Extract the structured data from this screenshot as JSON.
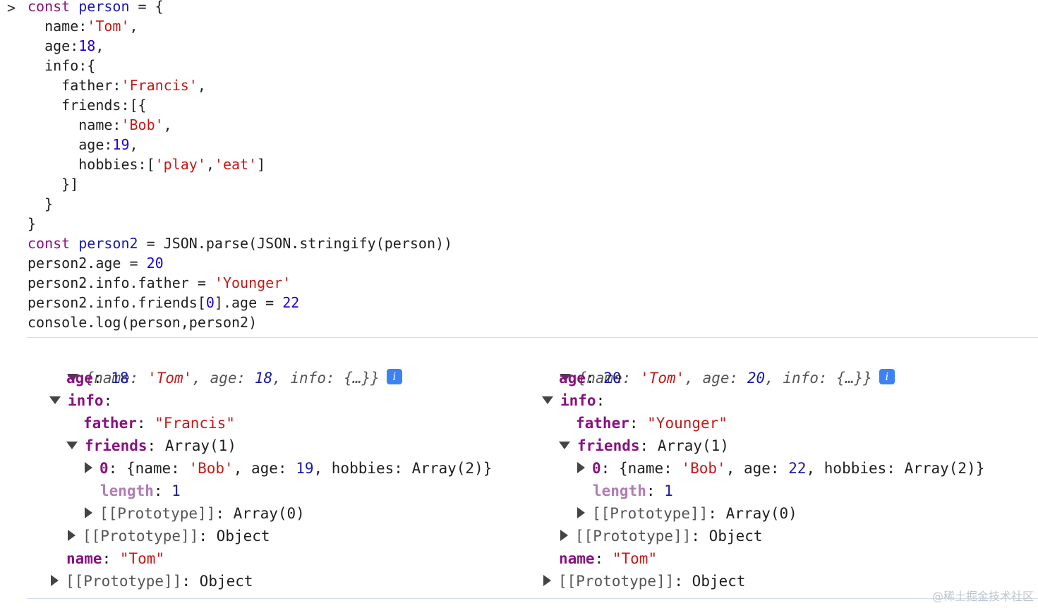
{
  "console": {
    "prompt_symbol": ">",
    "code_lines": [
      [
        [
          "const",
          "kw"
        ],
        [
          " ",
          ""
        ],
        [
          "person",
          "vr"
        ],
        [
          " = {",
          ""
        ]
      ],
      [
        [
          "  name:",
          ""
        ],
        [
          "'Tom'",
          "st"
        ],
        [
          ",",
          ""
        ]
      ],
      [
        [
          "  age:",
          ""
        ],
        [
          "18",
          "nm"
        ],
        [
          ",",
          ""
        ]
      ],
      [
        [
          "  info:{",
          ""
        ]
      ],
      [
        [
          "    father:",
          ""
        ],
        [
          "'Francis'",
          "st"
        ],
        [
          ",",
          ""
        ]
      ],
      [
        [
          "    friends:[{",
          ""
        ]
      ],
      [
        [
          "      name:",
          ""
        ],
        [
          "'Bob'",
          "st"
        ],
        [
          ",",
          ""
        ]
      ],
      [
        [
          "      age:",
          ""
        ],
        [
          "19",
          "nm"
        ],
        [
          ",",
          ""
        ]
      ],
      [
        [
          "      hobbies:[",
          ""
        ],
        [
          "'play'",
          "st"
        ],
        [
          ",",
          ""
        ],
        [
          "'eat'",
          "st"
        ],
        [
          "]",
          ""
        ]
      ],
      [
        [
          "    }]",
          ""
        ]
      ],
      [
        [
          "  }",
          ""
        ]
      ],
      [
        [
          "}",
          ""
        ]
      ],
      [
        [
          "const",
          "kw"
        ],
        [
          " ",
          ""
        ],
        [
          "person2",
          "vr"
        ],
        [
          " = JSON.parse(JSON.stringify(person))",
          ""
        ]
      ],
      [
        [
          "person2.age = ",
          ""
        ],
        [
          "20",
          "nm"
        ]
      ],
      [
        [
          "person2.info.father = ",
          ""
        ],
        [
          "'Younger'",
          "st"
        ]
      ],
      [
        [
          "person2.info.friends[",
          ""
        ],
        [
          "0",
          "nm"
        ],
        [
          "].age = ",
          ""
        ],
        [
          "22",
          "nm"
        ]
      ],
      [
        [
          "console.log(person,person2)",
          ""
        ]
      ]
    ]
  },
  "left": {
    "summary_open": "{name: ",
    "summary_name": "'Tom'",
    "summary_mid1": ", age: ",
    "summary_age": "18",
    "summary_mid2": ", info: {…}}",
    "age_key": "age",
    "age_val": "18",
    "info_key": "info",
    "father_key": "father",
    "father_val": "\"Francis\"",
    "friends_key": "friends",
    "friends_val": "Array(1)",
    "item_key": "0",
    "item_p1": "{name: ",
    "item_name": "'Bob'",
    "item_p2": ", age: ",
    "item_age": "19",
    "item_p3": ", hobbies: Array(2)}",
    "length_key": "length",
    "length_val": "1",
    "proto_array": "[[Prototype]]",
    "proto_array_val": "Array(0)",
    "proto_obj1": "[[Prototype]]",
    "proto_obj1_val": "Object",
    "name_key": "name",
    "name_val": "\"Tom\"",
    "proto_obj2": "[[Prototype]]",
    "proto_obj2_val": "Object"
  },
  "right": {
    "summary_open": "{name: ",
    "summary_name": "'Tom'",
    "summary_mid1": ", age: ",
    "summary_age": "20",
    "summary_mid2": ", info: {…}}",
    "age_key": "age",
    "age_val": "20",
    "info_key": "info",
    "father_key": "father",
    "father_val": "\"Younger\"",
    "friends_key": "friends",
    "friends_val": "Array(1)",
    "item_key": "0",
    "item_p1": "{name: ",
    "item_name": "'Bob'",
    "item_p2": ", age: ",
    "item_age": "22",
    "item_p3": ", hobbies: Array(2)}",
    "length_key": "length",
    "length_val": "1",
    "proto_array": "[[Prototype]]",
    "proto_array_val": "Array(0)",
    "proto_obj1": "[[Prototype]]",
    "proto_obj1_val": "Object",
    "name_key": "name",
    "name_val": "\"Tom\"",
    "proto_obj2": "[[Prototype]]",
    "proto_obj2_val": "Object"
  },
  "info_badge": "i",
  "watermark": "@稀土掘金技术社区"
}
